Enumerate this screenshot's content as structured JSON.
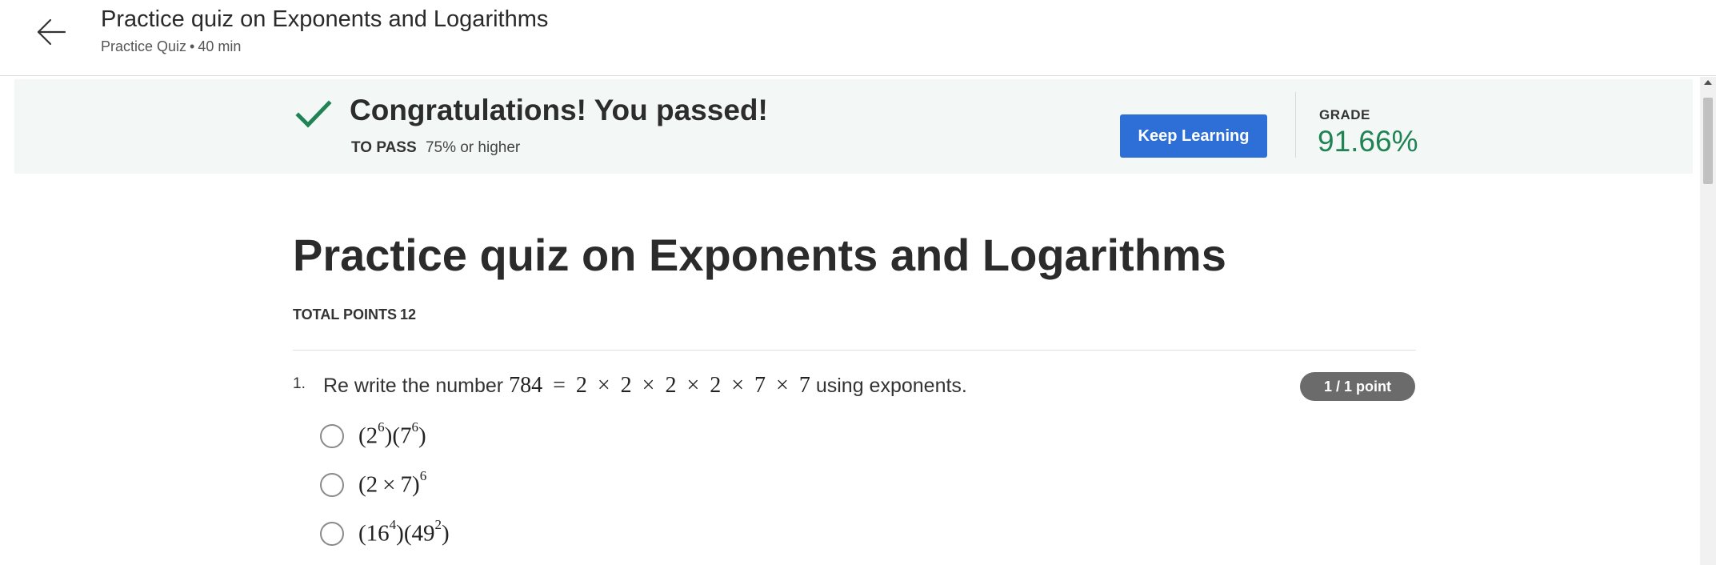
{
  "header": {
    "title": "Practice quiz on Exponents and Logarithms",
    "type": "Practice Quiz",
    "separator": "•",
    "duration": "40 min"
  },
  "banner": {
    "message": "Congratulations! You passed!",
    "to_pass_label": "TO PASS",
    "to_pass_value": "75% or higher",
    "button_label": "Keep Learning",
    "grade_label": "GRADE",
    "grade_value": "91.66%"
  },
  "quiz": {
    "title": "Practice quiz on Exponents and Logarithms",
    "total_points_label": "TOTAL POINTS",
    "total_points_value": "12"
  },
  "question1": {
    "number": "1.",
    "text_before": "Re write the number",
    "expression": {
      "n": "784",
      "eq": "=",
      "f1": "2",
      "f2": "2",
      "f3": "2",
      "f4": "2",
      "f5": "7",
      "f6": "7",
      "times": "×"
    },
    "text_after": "using exponents.",
    "score": "1 / 1 point",
    "options": [
      {
        "b1": "2",
        "e1": "6",
        "b2": "7",
        "e2": "6"
      },
      {
        "a": "2",
        "b": "7",
        "e": "6"
      },
      {
        "b1": "16",
        "e1": "4",
        "b2": "49",
        "e2": "2"
      }
    ]
  },
  "colors": {
    "brand_blue": "#2d6fd6",
    "pass_green": "#1f8354",
    "banner_bg": "#f3f8f6",
    "badge_gray": "#6b6b6b"
  },
  "icons": [
    "back-arrow-icon",
    "checkmark-icon"
  ]
}
